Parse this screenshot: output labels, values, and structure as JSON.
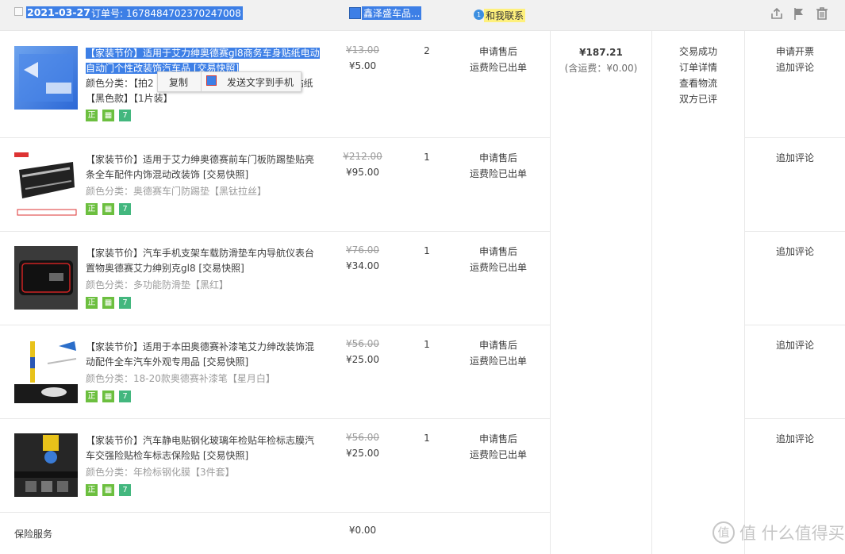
{
  "header": {
    "date": "2021-03-27",
    "order_no": "订单号: 1678484702370247008",
    "shop": "鑫泽盛车品...",
    "contact": "和我联系"
  },
  "context_menu": {
    "copy": "复制",
    "send": "发送文字到手机"
  },
  "order_total": {
    "amount": "¥187.21",
    "shipping": "(含运费：¥0.00)"
  },
  "trade_status": [
    "交易成功",
    "订单详情",
    "查看物流",
    "双方已评"
  ],
  "items": [
    {
      "title_a": "【家装节价】适用于艾力绅奥德赛gl8商务车身贴纸电动",
      "title_b": "自动门个性改装饰汽车品 [交易快照]",
      "attr_a": "颜色分类：【拍2",
      "attr_b": "贴纸",
      "attr_c": "【黑色款】【1片装】",
      "price_orig": "¥13.00",
      "price_new": "¥5.00",
      "qty": "2",
      "service": [
        "申请售后",
        "运费险已出单"
      ],
      "ops": [
        "申请开票",
        "追加评论"
      ]
    },
    {
      "title": "【家装节价】适用于艾力绅奥德赛前车门板防踢垫贴亮条全车配件内饰混动改装饰 [交易快照]",
      "attr": "颜色分类：奥德赛车门防踢垫【黑钛拉丝】",
      "price_orig": "¥212.00",
      "price_new": "¥95.00",
      "qty": "1",
      "service": [
        "申请售后",
        "运费险已出单"
      ],
      "ops": [
        "追加评论"
      ]
    },
    {
      "title": "【家装节价】汽车手机支架车载防滑垫车内导航仪表台置物奥德赛艾力绅别克gl8 [交易快照]",
      "attr": "颜色分类：多功能防滑垫【黑红】",
      "price_orig": "¥76.00",
      "price_new": "¥34.00",
      "qty": "1",
      "service": [
        "申请售后",
        "运费险已出单"
      ],
      "ops": [
        "追加评论"
      ]
    },
    {
      "title": "【家装节价】适用于本田奥德赛补漆笔艾力绅改装饰混动配件全车汽车外观专用品 [交易快照]",
      "attr": "颜色分类：18-20款奥德赛补漆笔【星月白】",
      "price_orig": "¥56.00",
      "price_new": "¥25.00",
      "qty": "1",
      "service": [
        "申请售后",
        "运费险已出单"
      ],
      "ops": [
        "追加评论"
      ]
    },
    {
      "title": "【家装节价】汽车静电贴钢化玻璃年检贴年检标志膜汽车交强险贴检车标志保险贴 [交易快照]",
      "attr": "颜色分类：年检标钢化膜【3件套】",
      "price_orig": "¥56.00",
      "price_new": "¥25.00",
      "qty": "1",
      "service": [
        "申请售后",
        "运费险已出单"
      ],
      "ops": [
        "追加评论"
      ]
    }
  ],
  "insurance": {
    "label": "保险服务",
    "price": "¥0.00"
  },
  "watermark": "值 什么值得买",
  "badges": {
    "zheng": "正",
    "seven": "7"
  },
  "colors": {
    "accent": "#3d7fe6",
    "header_bg": "#f1f1f1",
    "contact_bg": "#fef07c"
  }
}
